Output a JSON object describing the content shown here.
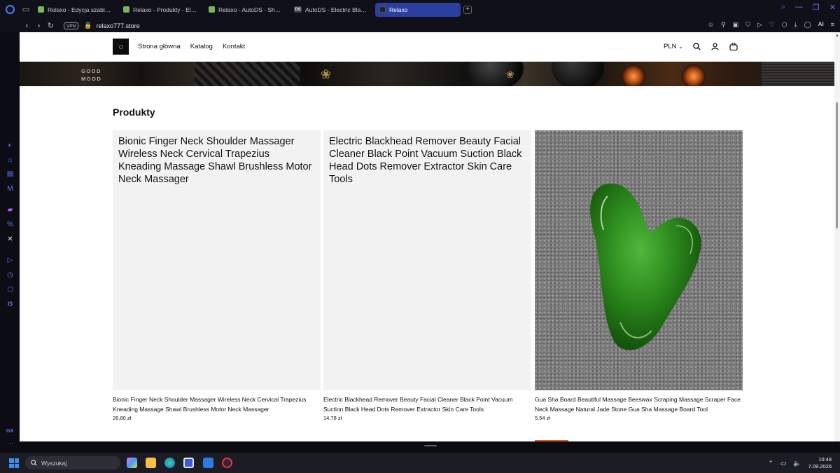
{
  "browser": {
    "tabs": [
      {
        "label": "Relaxo - Edycja szablonu H",
        "favicon": "shopify"
      },
      {
        "label": "Relaxo - Produkty - Electric",
        "favicon": "shopify"
      },
      {
        "label": "Relaxo - AutoDS - Shopify",
        "favicon": "shopify"
      },
      {
        "label": "AutoDS - Electric Blackhea",
        "favicon": "autods"
      },
      {
        "label": "Relaxo",
        "favicon": "relaxo",
        "active": true
      }
    ],
    "new_tab": "+",
    "vpn_label": "VPN",
    "url": "relaxo777.store",
    "ai_label": "AI"
  },
  "site": {
    "nav": [
      "Strona główna",
      "Katalog",
      "Kontakt"
    ],
    "currency": "PLN",
    "banner_text": [
      "GOOD",
      "MOOD"
    ],
    "section_title": "Produkty",
    "products": [
      {
        "placeholder": "Bionic Finger Neck Shoulder Massager Wireless Neck Cervical Trapezius Kneading Massage Shawl Brushless Motor Neck Massager",
        "title": "Bionic Finger Neck Shoulder Massager Wireless Neck Cervical Trapezius Kneading Massage Shawl Brushless Motor Neck Massager",
        "price": "26,80 zł"
      },
      {
        "placeholder": "Electric Blackhead Remover Beauty Facial Cleaner Black Point Vacuum Suction Black Head Dots Remover Extractor Skin Care Tools",
        "title": "Electric Blackhead Remover Beauty Facial Cleaner Black Point Vacuum Suction Black Head Dots Remover Extractor Skin Care Tools",
        "price": "14,78 zł"
      },
      {
        "title": "Gua Sha Board Beautiful Massage Beeswax Scraping Massage Scraper Face Neck Massage Natural Jade Stone Gua Sha Massage Board Tool",
        "price": "5,54 zł"
      }
    ]
  },
  "sidebar": {
    "gx_label": "GX"
  },
  "taskbar": {
    "search_placeholder": "Wyszukaj",
    "time": "10:48",
    "date": "7.09.2026"
  },
  "colors": {
    "accent": "#2a3f9e",
    "opera_blue": "#4d7cff",
    "jade": "#2e8b1e",
    "sale_bar": "#e25a1c"
  }
}
